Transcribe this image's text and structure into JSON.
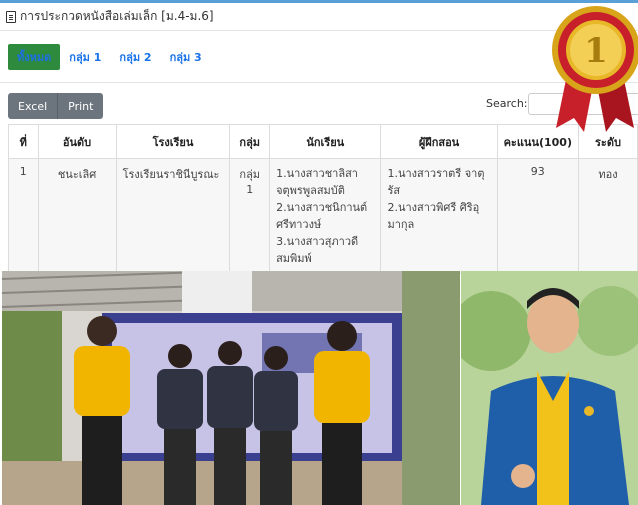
{
  "page": {
    "title": "การประกวดหนังสือเล่มเล็ก [ม.4-ม.6]"
  },
  "tabs": [
    {
      "label": "ทั้งหมด"
    },
    {
      "label": "กลุ่ม 1"
    },
    {
      "label": "กลุ่ม 2"
    },
    {
      "label": "กลุ่ม 3"
    }
  ],
  "toolbar": {
    "excel_label": "Excel",
    "print_label": "Print",
    "search_label": "Search:",
    "search_value": ""
  },
  "table": {
    "headers": [
      "ที่",
      "อันดับ",
      "โรงเรียน",
      "กลุ่ม",
      "นักเรียน",
      "ผู้ฝึกสอน",
      "คะแนน(100)",
      "ระดับ"
    ],
    "rows": [
      {
        "no": "1",
        "rank": "ชนะเลิศ",
        "school": "โรงเรียนราชินีบูรณะ",
        "group": "กลุ่ม 1",
        "students": [
          "1.นางสาวชาลิสา จตุพรพูลสมบัติ",
          "2.นางสาวชนิกานต์ ศรีทาวงษ์",
          "3.นางสาวสุภาวดี สมพิมพ์"
        ],
        "trainers": [
          "1.นางสาวราตรี จาตุรัส",
          "2.นางสาวพิศรี ศิริอุมากุล"
        ],
        "score": "93",
        "level": "ทอง"
      }
    ]
  },
  "images": {
    "left_photo": "group-photo",
    "right_photo": "portrait-photo",
    "medal": "first-place-medal-icon"
  },
  "colors": {
    "active_tab": "#2e8b3e",
    "tab_text": "#1a73e8",
    "button_bg": "#6c757d",
    "medal_gold": "#e8b829",
    "medal_ribbon": "#c8202a"
  }
}
